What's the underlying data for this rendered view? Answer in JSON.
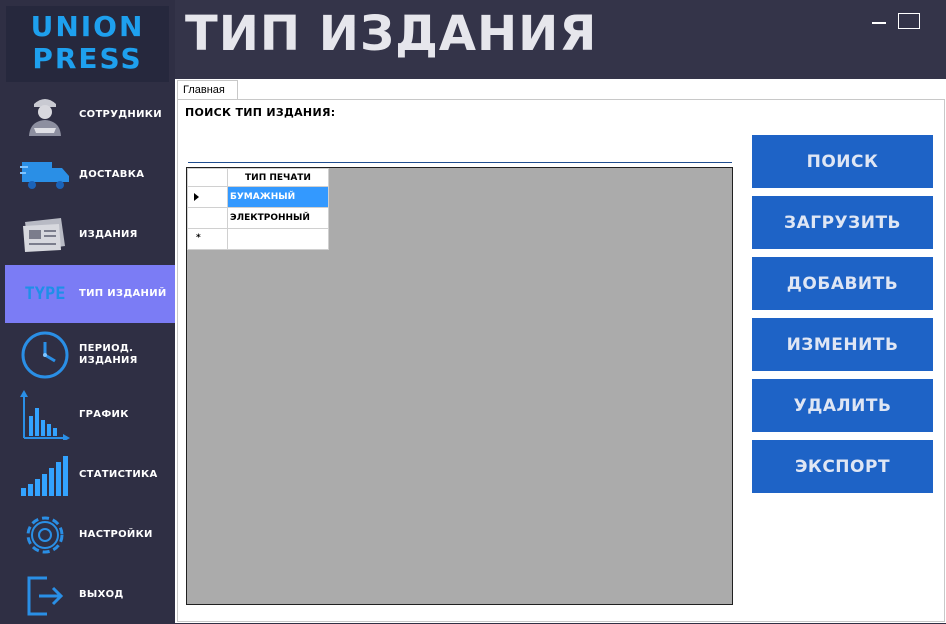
{
  "app": {
    "logo_line1": "UNION",
    "logo_line2": "PRESS",
    "page_title": "ТИП ИЗДАНИЯ"
  },
  "colors": {
    "sidebar_bg": "#2f2f44",
    "active_item": "#7b7cf5",
    "logo_text": "#1ea0ee",
    "button_bg": "#1e63c6",
    "selected_cell": "#3399ff",
    "grid_bg": "#ababab"
  },
  "sidebar": {
    "items": [
      {
        "label": "СОТРУДНИКИ",
        "icon": "worker-icon"
      },
      {
        "label": "ДОСТАВКА",
        "icon": "truck-icon"
      },
      {
        "label": "ИЗДАНИЯ",
        "icon": "newspaper-icon"
      },
      {
        "label": "ТИП ИЗДАНИЙ",
        "icon": "type-icon",
        "icon_text": "TYPE",
        "active": true
      },
      {
        "label": "ПЕРИОД.\nИЗДАНИЯ",
        "icon": "clock-icon"
      },
      {
        "label": "ГРАФИК",
        "icon": "bar-chart-icon"
      },
      {
        "label": "СТАТИСТИКА",
        "icon": "stats-icon"
      },
      {
        "label": "НАСТРОЙКИ",
        "icon": "gear-icon"
      },
      {
        "label": "ВЫХОД",
        "icon": "exit-icon"
      }
    ]
  },
  "tabs": [
    {
      "label": "Главная"
    }
  ],
  "search": {
    "label": "ПОИСК ТИП ИЗДАНИЯ:",
    "value": ""
  },
  "grid": {
    "columns": [
      "ТИП ПЕЧАТИ"
    ],
    "rows": [
      "БУМАЖНЫЙ",
      "ЭЛЕКТРОННЫЙ"
    ],
    "new_row_marker": "*"
  },
  "buttons": {
    "search": "ПОИСК",
    "load": "ЗАГРУЗИТЬ",
    "add": "ДОБАВИТЬ",
    "edit": "ИЗМЕНИТЬ",
    "delete": "УДАЛИТЬ",
    "export": "ЭКСПОРТ"
  }
}
